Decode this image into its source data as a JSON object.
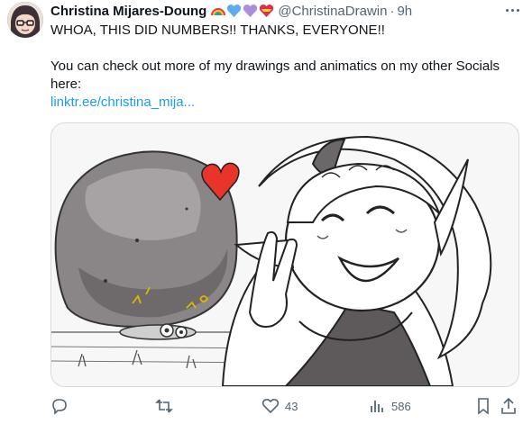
{
  "tweet": {
    "author_name": "Christina Mijares-Doung",
    "author_handle": "@ChristinaDrawin",
    "separator": "·",
    "time": "9h",
    "emoji": [
      "rainbow",
      "blue-heart",
      "purple-heart",
      "heart-with-ribbon"
    ],
    "text_line1": "WHOA, THIS DID NUMBERS!! THANKS, EVERYONE!!",
    "text_line2": "You can check out more of my drawings and animatics on my other Socials here:",
    "link_text": "linktr.ee/christina_mija...",
    "media": {
      "description_icons": [
        "boulder",
        "heart",
        "character",
        "peace-sign"
      ]
    }
  },
  "actions": {
    "reply_count": "",
    "retweet_count": "",
    "like_count": "43",
    "views_count": "586"
  },
  "colors": {
    "text": "#0f1419",
    "muted": "#536471",
    "link": "#1d9bf0",
    "border": "#cfd9de",
    "heart": "#e8342a"
  }
}
